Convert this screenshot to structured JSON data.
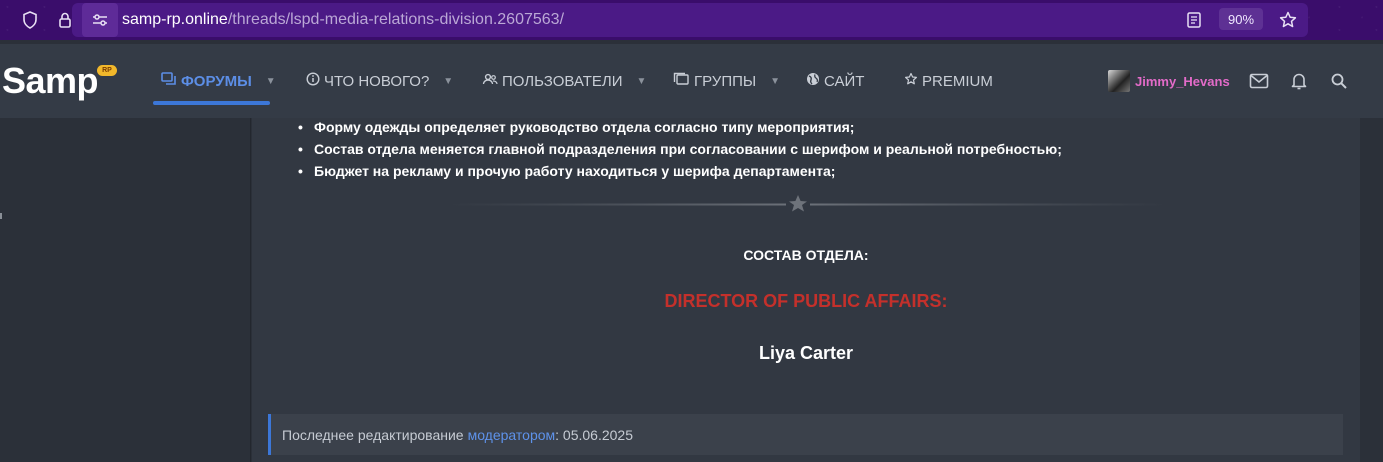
{
  "browser": {
    "url_host": "samp-rp.online",
    "url_path": "/threads/lspd-media-relations-division.2607563/",
    "zoom": "90%"
  },
  "header": {
    "logo": "Samp",
    "logo_badge": "RP",
    "nav": [
      {
        "label": "ФОРУМЫ",
        "icon": "forums-icon",
        "active": true,
        "has_caret": true
      },
      {
        "label": "ЧТО НОВОГО?",
        "icon": "info-icon",
        "active": false,
        "has_caret": true
      },
      {
        "label": "ПОЛЬЗОВАТЕЛИ",
        "icon": "users-icon",
        "active": false,
        "has_caret": true
      },
      {
        "label": "ГРУППЫ",
        "icon": "groups-icon",
        "active": false,
        "has_caret": true
      },
      {
        "label": "САЙТ",
        "icon": "globe-icon",
        "active": false,
        "has_caret": false
      },
      {
        "label": "PREMIUM",
        "icon": "star-icon",
        "active": false,
        "has_caret": false
      }
    ],
    "username": "Jimmy_Hevans"
  },
  "post": {
    "bullets": [
      "Форму одежды определяет руководство отдела согласно типу мероприятия;",
      "Состав отдела меняется главной подразделения при согласовании с шерифом и реальной потребностью;",
      "Бюджет на рекламу и прочую работу находиться у шерифа департамента;"
    ],
    "section_title": "СОСТАВ ОТДЕЛА:",
    "role_title": "DIRECTOR OF PUBLIC AFFAIRS:",
    "person": "Liya Carter",
    "edited_prefix": "Последнее редактирование",
    "edited_link": "модератором",
    "edited_suffix": ": 05.06.2025"
  },
  "colors": {
    "browser_bar": "#3a0d6b",
    "header_bg": "#343b46",
    "accent": "#3c77d8",
    "role_red": "#c4302b",
    "username": "#e36bc9"
  }
}
